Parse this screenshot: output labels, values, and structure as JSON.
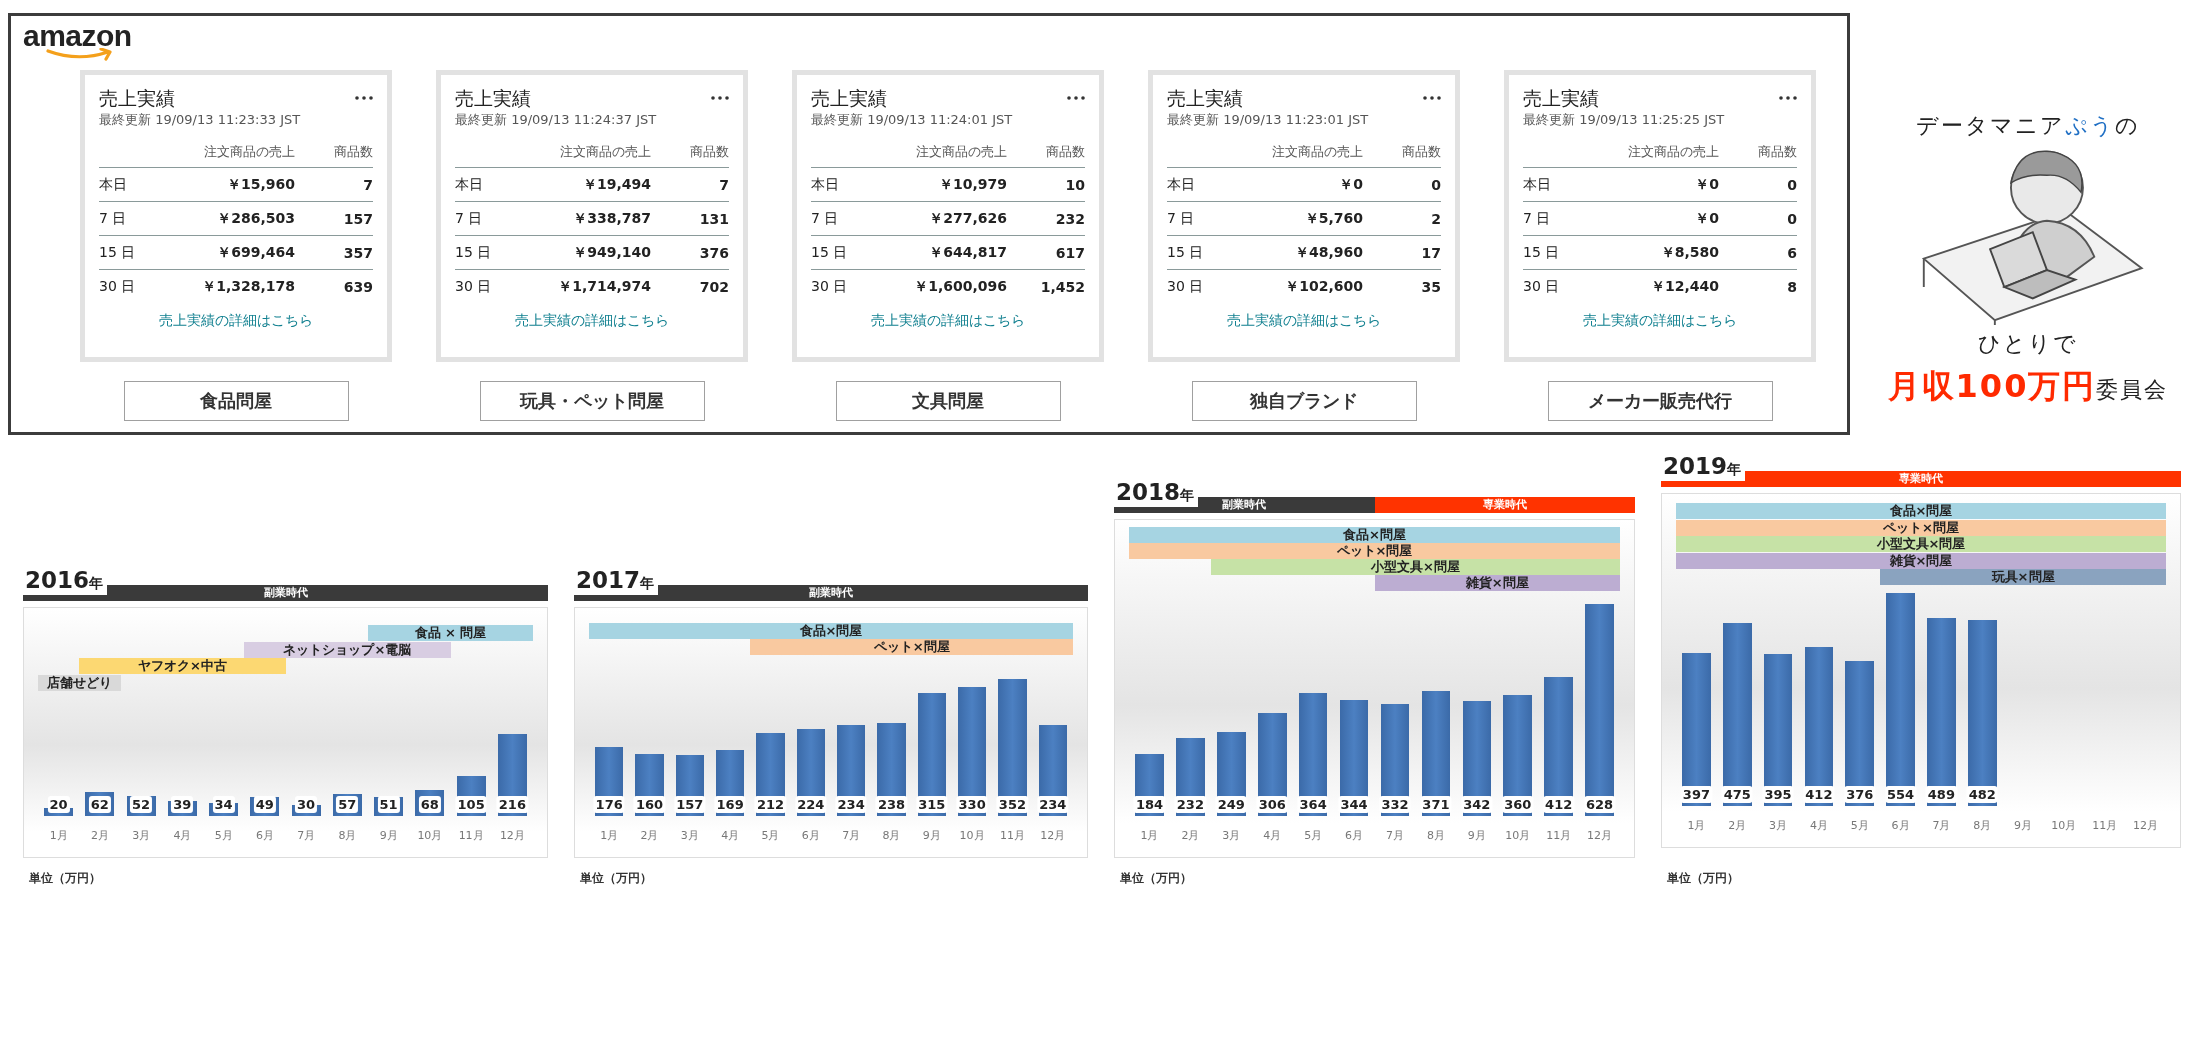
{
  "seller_panel": {
    "logo": "amazon",
    "cards": [
      {
        "title": "売上実績",
        "updated": "最終更新 19/09/13 11:23:33 JST",
        "columns": [
          "注文商品の売上",
          "商品数"
        ],
        "rows": [
          {
            "period": "本日",
            "sales": "￥15,960",
            "units": "7"
          },
          {
            "period": "7 日",
            "sales": "￥286,503",
            "units": "157"
          },
          {
            "period": "15 日",
            "sales": "￥699,464",
            "units": "357"
          },
          {
            "period": "30 日",
            "sales": "￥1,328,178",
            "units": "639"
          }
        ],
        "link": "売上実績の詳細はこちら",
        "button": "食品問屋"
      },
      {
        "title": "売上実績",
        "updated": "最終更新 19/09/13 11:24:37 JST",
        "columns": [
          "注文商品の売上",
          "商品数"
        ],
        "rows": [
          {
            "period": "本日",
            "sales": "￥19,494",
            "units": "7"
          },
          {
            "period": "7 日",
            "sales": "￥338,787",
            "units": "131"
          },
          {
            "period": "15 日",
            "sales": "￥949,140",
            "units": "376"
          },
          {
            "period": "30 日",
            "sales": "￥1,714,974",
            "units": "702"
          }
        ],
        "link": "売上実績の詳細はこちら",
        "button": "玩具・ペット問屋"
      },
      {
        "title": "売上実績",
        "updated": "最終更新 19/09/13 11:24:01 JST",
        "columns": [
          "注文商品の売上",
          "商品数"
        ],
        "rows": [
          {
            "period": "本日",
            "sales": "￥10,979",
            "units": "10"
          },
          {
            "period": "7 日",
            "sales": "￥277,626",
            "units": "232"
          },
          {
            "period": "15 日",
            "sales": "￥644,817",
            "units": "617"
          },
          {
            "period": "30 日",
            "sales": "￥1,600,096",
            "units": "1,452"
          }
        ],
        "link": "売上実績の詳細はこちら",
        "button": "文具問屋"
      },
      {
        "title": "売上実績",
        "updated": "最終更新 19/09/13 11:23:01 JST",
        "columns": [
          "注文商品の売上",
          "商品数"
        ],
        "rows": [
          {
            "period": "本日",
            "sales": "￥0",
            "units": "0"
          },
          {
            "period": "7 日",
            "sales": "￥5,760",
            "units": "2"
          },
          {
            "period": "15 日",
            "sales": "￥48,960",
            "units": "17"
          },
          {
            "period": "30 日",
            "sales": "￥102,600",
            "units": "35"
          }
        ],
        "link": "売上実績の詳細はこちら",
        "button": "独自ブランド"
      },
      {
        "title": "売上実績",
        "updated": "最終更新 19/09/13 11:25:25 JST",
        "columns": [
          "注文商品の売上",
          "商品数"
        ],
        "rows": [
          {
            "period": "本日",
            "sales": "￥0",
            "units": "0"
          },
          {
            "period": "7 日",
            "sales": "￥0",
            "units": "0"
          },
          {
            "period": "15 日",
            "sales": "￥8,580",
            "units": "6"
          },
          {
            "period": "30 日",
            "sales": "￥12,440",
            "units": "8"
          }
        ],
        "link": "売上実績の詳細はこちら",
        "button": "メーカー販売代行"
      }
    ]
  },
  "brand": {
    "lines": [
      [
        {
          "text": "データマニア",
          "color": "#222222"
        },
        {
          "text": "ぷう",
          "color": "#1f6fc4"
        },
        {
          "text": "の",
          "color": "#222222"
        }
      ],
      [
        {
          "text": "ひとりで",
          "color": "#222222"
        }
      ],
      [
        {
          "text": "月収100万円",
          "color": "#ff2a00"
        },
        {
          "text": "委員会",
          "color": "#222222"
        }
      ]
    ]
  },
  "charts": [
    {
      "year": "2016",
      "year_unit": "年",
      "eras": [
        {
          "label": "副業時代",
          "color": "#3a3a3a"
        }
      ],
      "bands": [
        {
          "label": "食品 × 問屋",
          "color": "#a6d4e2"
        },
        {
          "label": "ネットショップ×電脳",
          "color": "#d8cde2"
        },
        {
          "label": "ヤフオク×中古",
          "color": "#fcd872"
        },
        {
          "label": "店舗せどり",
          "color": "#d9d9d9"
        }
      ],
      "chart_data": {
        "type": "bar",
        "categories": [
          "1月",
          "2月",
          "3月",
          "4月",
          "5月",
          "6月",
          "7月",
          "8月",
          "9月",
          "10月",
          "11月",
          "12月"
        ],
        "values": [
          20,
          62,
          52,
          39,
          34,
          49,
          30,
          57,
          51,
          68,
          105,
          216
        ],
        "data_labels": true
      },
      "unit_note": "単位（万円）"
    },
    {
      "year": "2017",
      "year_unit": "年",
      "eras": [
        {
          "label": "副業時代",
          "color": "#3a3a3a"
        }
      ],
      "bands": [
        {
          "label": "食品×問屋",
          "color": "#a6d4e2"
        },
        {
          "label": "ペット×問屋",
          "color": "#f9c9a0"
        }
      ],
      "chart_data": {
        "type": "bar",
        "categories": [
          "1月",
          "2月",
          "3月",
          "4月",
          "5月",
          "6月",
          "7月",
          "8月",
          "9月",
          "10月",
          "11月",
          "12月"
        ],
        "values": [
          176,
          160,
          157,
          169,
          212,
          224,
          234,
          238,
          315,
          330,
          352,
          234
        ],
        "data_labels": true
      },
      "unit_note": "単位（万円）"
    },
    {
      "year": "2018",
      "year_unit": "年",
      "eras": [
        {
          "label": "副業時代",
          "color": "#3a3a3a"
        },
        {
          "label": "専業時代",
          "color": "#ff3300"
        }
      ],
      "bands": [
        {
          "label": "食品×問屋",
          "color": "#a6d4e2"
        },
        {
          "label": "ペット×問屋",
          "color": "#f9c9a0"
        },
        {
          "label": "小型文具×問屋",
          "color": "#c6e2a6"
        },
        {
          "label": "雑貨×問屋",
          "color": "#bcadd2"
        }
      ],
      "chart_data": {
        "type": "bar",
        "categories": [
          "1月",
          "2月",
          "3月",
          "4月",
          "5月",
          "6月",
          "7月",
          "8月",
          "9月",
          "10月",
          "11月",
          "12月"
        ],
        "values": [
          184,
          232,
          249,
          306,
          364,
          344,
          332,
          371,
          342,
          360,
          412,
          628
        ],
        "data_labels": true
      },
      "unit_note": "単位（万円）"
    },
    {
      "year": "2019",
      "year_unit": "年",
      "eras": [
        {
          "label": "専業時代",
          "color": "#ff3300"
        }
      ],
      "bands": [
        {
          "label": "食品×問屋",
          "color": "#a6d4e2"
        },
        {
          "label": "ペット×問屋",
          "color": "#f9c9a0"
        },
        {
          "label": "小型文具×問屋",
          "color": "#c6e2a6"
        },
        {
          "label": "雑貨×問屋",
          "color": "#bcadd2"
        },
        {
          "label": "玩具×問屋",
          "color": "#8aa3bf"
        }
      ],
      "chart_data": {
        "type": "bar",
        "categories": [
          "1月",
          "2月",
          "3月",
          "4月",
          "5月",
          "6月",
          "7月",
          "8月",
          "9月",
          "10月",
          "11月",
          "12月"
        ],
        "values": [
          397,
          475,
          395,
          412,
          376,
          554,
          489,
          482,
          null,
          null,
          null,
          null
        ],
        "data_labels": true
      },
      "unit_note": "単位（万円）"
    }
  ]
}
